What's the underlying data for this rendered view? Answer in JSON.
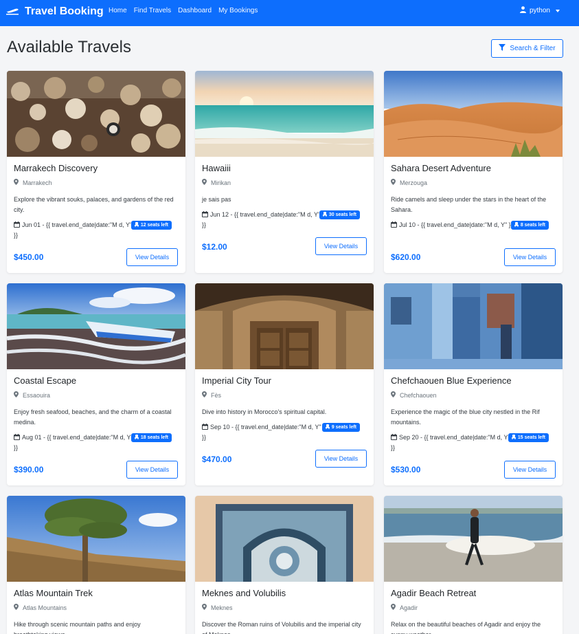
{
  "brand": {
    "name": "Travel Booking"
  },
  "nav": {
    "links": [
      "Home",
      "Find Travels",
      "Dashboard",
      "My Bookings"
    ]
  },
  "user": {
    "name": "python"
  },
  "page": {
    "title": "Available Travels",
    "filter_button": "Search & Filter"
  },
  "cards": [
    {
      "title": "Marrakech Discovery",
      "location": "Marrakech",
      "description": "Explore the vibrant souks, palaces, and gardens of the red city.",
      "dates": "Jun 01 - {{ travel.end_date|date:\"M d, Y\" }}",
      "seats": "12 seats left",
      "price": "$450.00",
      "button": "View Details",
      "image": "market"
    },
    {
      "title": "Hawaiii",
      "location": "Mirikan",
      "description": "je sais pas",
      "dates": "Jun 12 - {{ travel.end_date|date:\"M d, Y\" }}",
      "seats": "30 seats left",
      "price": "$12.00",
      "button": "View Details",
      "image": "beach-sunset"
    },
    {
      "title": "Sahara Desert Adventure",
      "location": "Merzouga",
      "description": "Ride camels and sleep under the stars in the heart of the Sahara.",
      "dates": "Jul 10 - {{ travel.end_date|date:\"M d, Y\" }}",
      "seats": "8 seats left",
      "price": "$620.00",
      "button": "View Details",
      "image": "desert"
    },
    {
      "title": "Coastal Escape",
      "location": "Essaouira",
      "description": "Enjoy fresh seafood, beaches, and the charm of a coastal medina.",
      "dates": "Aug 01 - {{ travel.end_date|date:\"M d, Y\" }}",
      "seats": "18 seats left",
      "price": "$390.00",
      "button": "View Details",
      "image": "boat"
    },
    {
      "title": "Imperial City Tour",
      "location": "Fès",
      "description": "Dive into history in Morocco's spiritual capital.",
      "dates": "Sep 10 - {{ travel.end_date|date:\"M d, Y\" }}",
      "seats": "9 seats left",
      "price": "$470.00",
      "button": "View Details",
      "image": "palace-door"
    },
    {
      "title": "Chefchaouen Blue Experience",
      "location": "Chefchaouen",
      "description": "Experience the magic of the blue city nestled in the Rif mountains.",
      "dates": "Sep 20 - {{ travel.end_date|date:\"M d, Y\" }}",
      "seats": "15 seats left",
      "price": "$530.00",
      "button": "View Details",
      "image": "blue-city"
    },
    {
      "title": "Atlas Mountain Trek",
      "location": "Atlas Mountains",
      "description": "Hike through scenic mountain paths and enjoy breathtaking views.",
      "image": "mountain-tree"
    },
    {
      "title": "Meknes and Volubilis",
      "location": "Meknes",
      "description": "Discover the Roman ruins of Volubilis and the imperial city of Meknes.",
      "image": "mosaic-arch"
    },
    {
      "title": "Agadir Beach Retreat",
      "location": "Agadir",
      "description": "Relax on the beautiful beaches of Agadir and enjoy the sunny weather.",
      "image": "surfer"
    }
  ],
  "colors": {
    "primary": "#0d6efd",
    "background": "#f4f5f7"
  },
  "icons": {
    "brand": "plane-icon",
    "user": "user-icon",
    "filter": "filter-icon",
    "location": "map-pin-icon",
    "dates": "calendar-icon",
    "seats": "seat-icon"
  }
}
